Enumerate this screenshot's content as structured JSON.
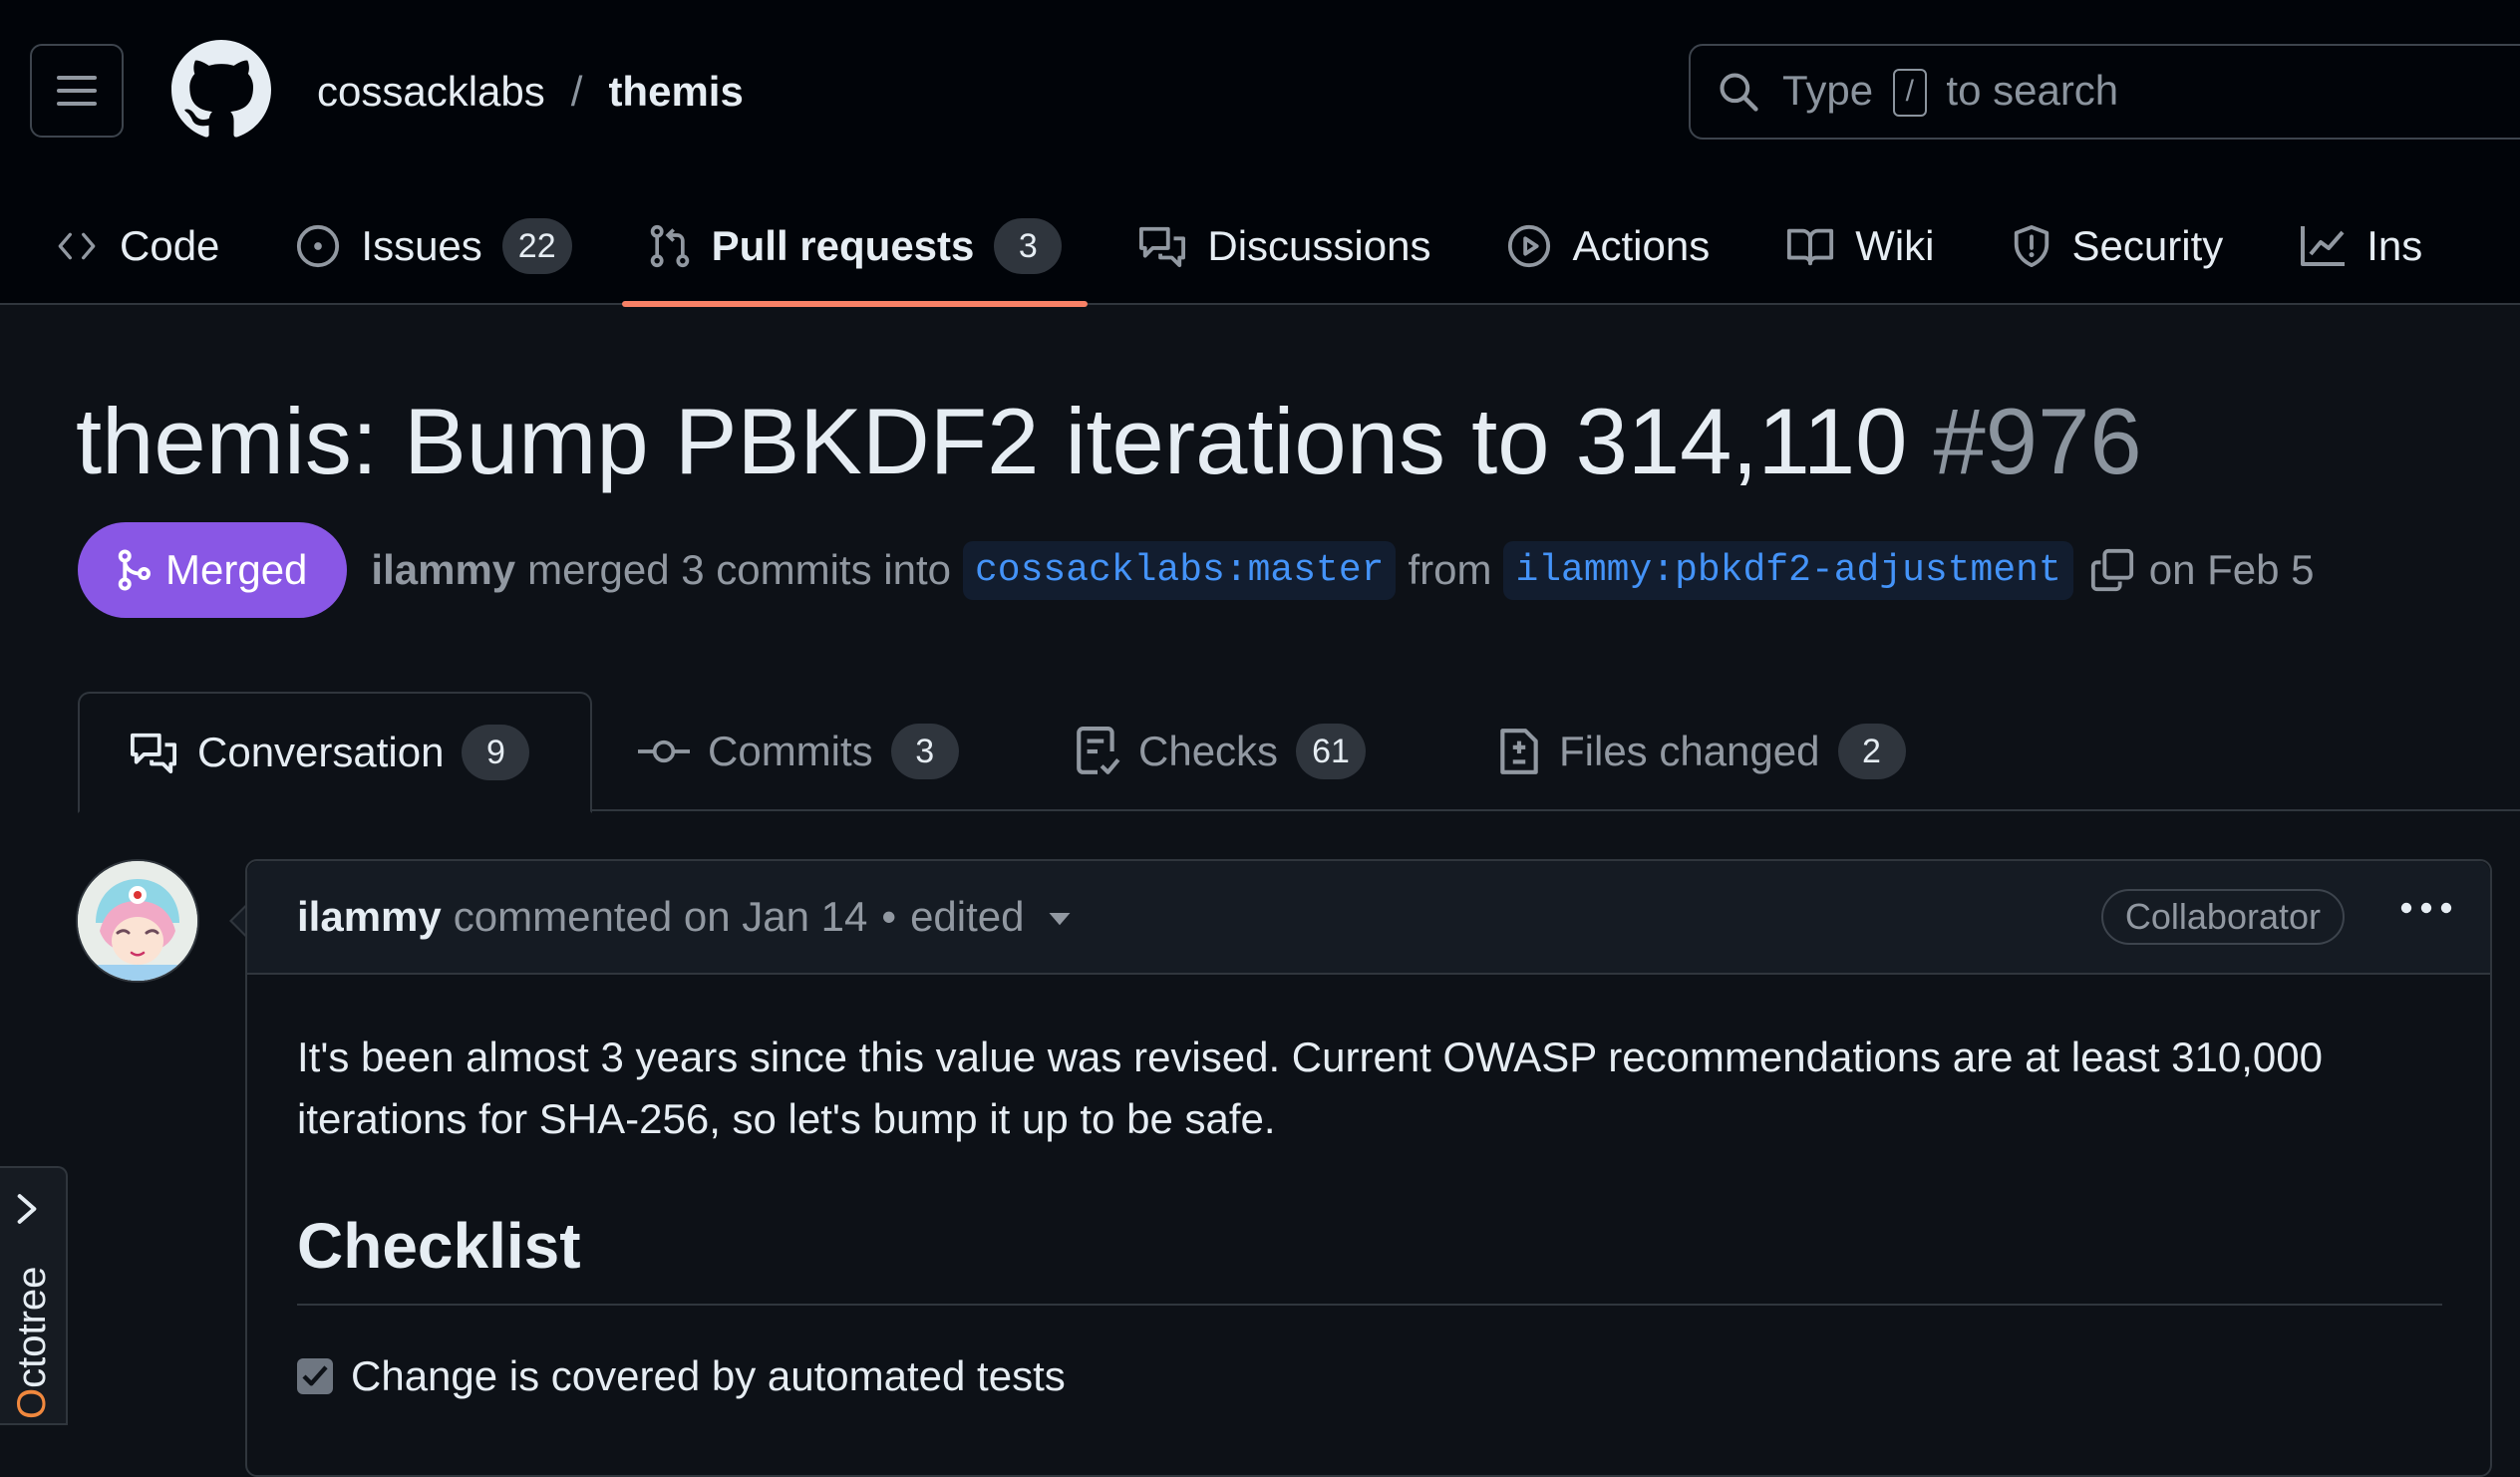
{
  "header": {
    "owner": "cossacklabs",
    "separator": "/",
    "repo": "themis",
    "search": {
      "prefix": "Type",
      "key": "/",
      "suffix": "to search"
    }
  },
  "repo_nav": {
    "tabs": [
      {
        "label": "Code",
        "icon": "code-icon"
      },
      {
        "label": "Issues",
        "icon": "issue-opened-icon",
        "count": "22"
      },
      {
        "label": "Pull requests",
        "icon": "git-pull-request-icon",
        "count": "3",
        "active": true
      },
      {
        "label": "Discussions",
        "icon": "comment-discussion-icon"
      },
      {
        "label": "Actions",
        "icon": "play-icon"
      },
      {
        "label": "Wiki",
        "icon": "book-icon"
      },
      {
        "label": "Security",
        "icon": "shield-icon"
      },
      {
        "label": "Ins",
        "icon": "graph-icon"
      }
    ]
  },
  "pr": {
    "title": "themis: Bump PBKDF2 iterations to 314,110",
    "number": "#976",
    "state": "Merged",
    "author": "ilammy",
    "merged_text": "merged 3 commits into",
    "base_branch": "cossacklabs:master",
    "from_text": "from",
    "head_branch": "ilammy:pbkdf2-adjustment",
    "date_text": "on Feb 5"
  },
  "pr_tabs": [
    {
      "label": "Conversation",
      "count": "9",
      "icon": "comment-discussion-icon"
    },
    {
      "label": "Commits",
      "count": "3",
      "icon": "git-commit-icon"
    },
    {
      "label": "Checks",
      "count": "61",
      "icon": "checklist-icon"
    },
    {
      "label": "Files changed",
      "count": "2",
      "icon": "file-diff-icon"
    }
  ],
  "comment": {
    "author": "ilammy",
    "action": "commented on Jan 14",
    "separator": "•",
    "edited": "edited",
    "role": "Collaborator",
    "body": "It's been almost 3 years since this value was revised. Current OWASP recommendations are at least 310,000 iterations for SHA-256, so let's bump it up to be safe.",
    "checklist_heading": "Checklist",
    "checklist_items": [
      {
        "label": "Change is covered by automated tests",
        "checked": true
      }
    ]
  },
  "octotree": {
    "first": "O",
    "rest": "ctotree"
  },
  "colors": {
    "background": "#0d1117",
    "header": "#010409",
    "merged": "#8957e5",
    "active_tab_underline": "#f78166",
    "link": "#4493f8"
  }
}
